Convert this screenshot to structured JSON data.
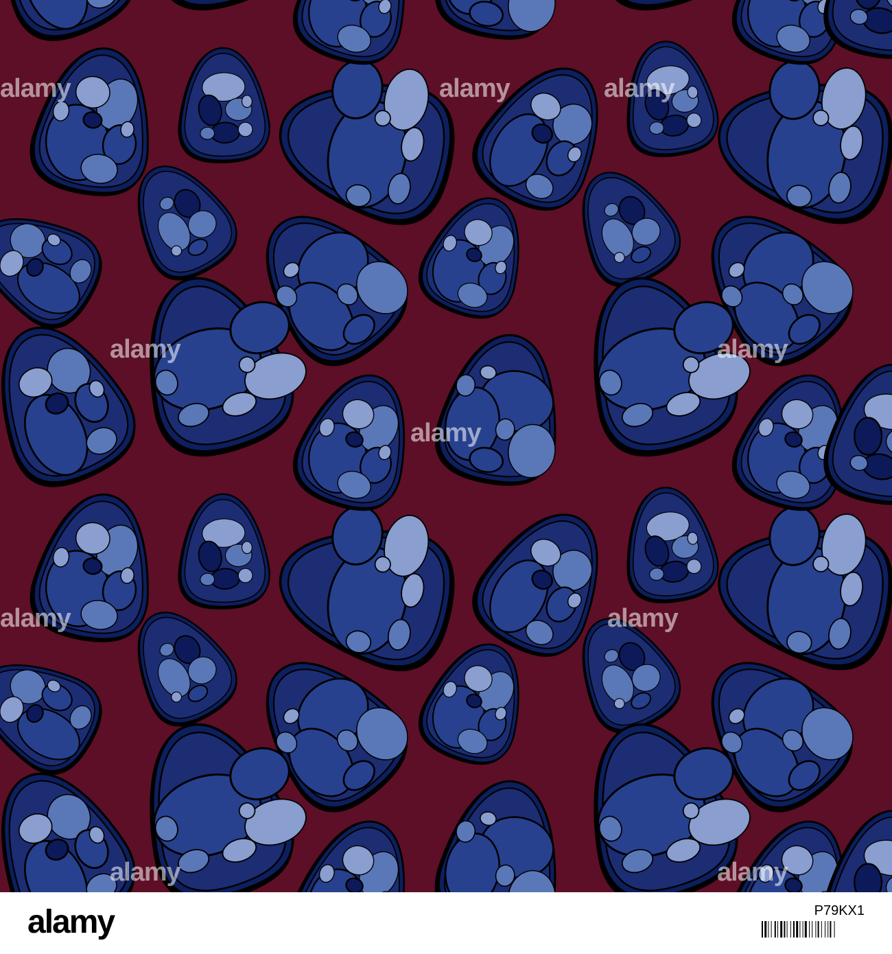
{
  "watermark": {
    "text": "alamy"
  },
  "footer": {
    "logo_text": "alamy",
    "image_code": "P79KX1"
  },
  "colors": {
    "background": "#5c0f26",
    "egg_outline": "#000000",
    "egg_rim": "#0e1f5e",
    "egg_body": "#1c2d73",
    "spot_dark": "#0d1a5a",
    "spot_mid": "#27418f",
    "spot_light": "#5a78b8",
    "spot_pale": "#8a9ecf"
  },
  "pattern": {
    "description_kind": "seamless pattern of blue mosaic eggs",
    "icon": "egg-icon"
  }
}
